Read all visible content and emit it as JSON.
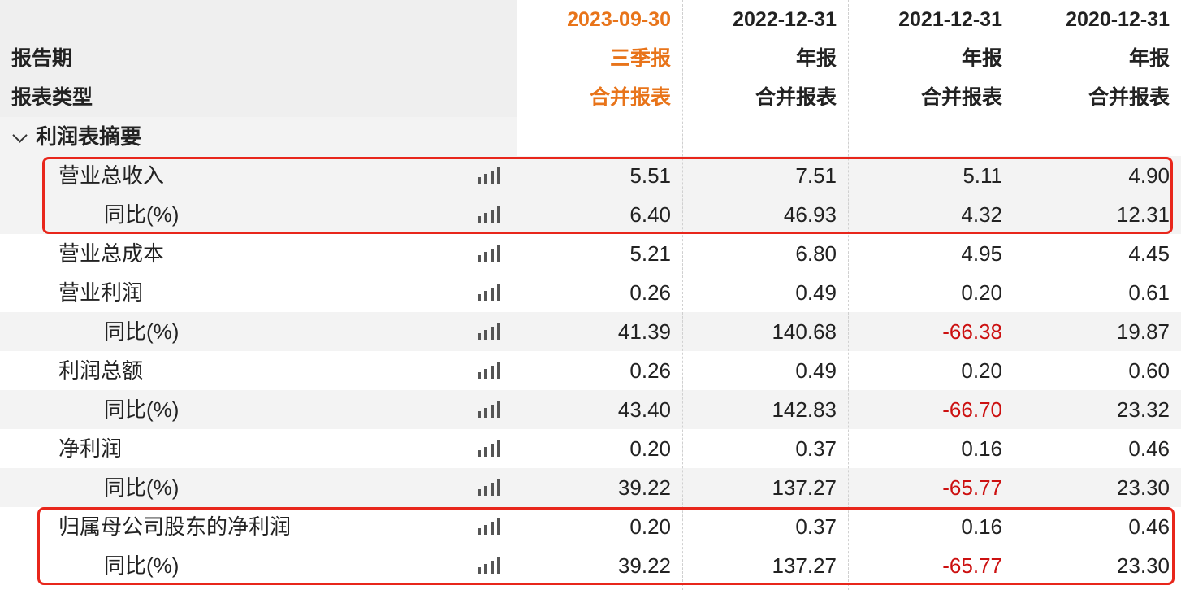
{
  "header": {
    "row_labels": [
      "报告期",
      "报表类型"
    ],
    "periods": [
      {
        "date": "2023-09-30",
        "report": "三季报",
        "type": "合并报表",
        "accent": "#e8741a"
      },
      {
        "date": "2022-12-31",
        "report": "年报",
        "type": "合并报表"
      },
      {
        "date": "2021-12-31",
        "report": "年报",
        "type": "合并报表"
      },
      {
        "date": "2020-12-31",
        "report": "年报",
        "type": "合并报表"
      }
    ]
  },
  "section": {
    "title": "利润表摘要",
    "icon": "chevron-down-icon"
  },
  "rows": [
    {
      "label": "营业总收入",
      "values": [
        "5.51",
        "7.51",
        "5.11",
        "4.90"
      ]
    },
    {
      "label": "同比(%)",
      "values": [
        "6.40",
        "46.93",
        "4.32",
        "12.31"
      ]
    },
    {
      "label": "营业总成本",
      "values": [
        "5.21",
        "6.80",
        "4.95",
        "4.45"
      ]
    },
    {
      "label": "营业利润",
      "values": [
        "0.26",
        "0.49",
        "0.20",
        "0.61"
      ]
    },
    {
      "label": "同比(%)",
      "values": [
        "41.39",
        "140.68",
        "-66.38",
        "19.87"
      ]
    },
    {
      "label": "利润总额",
      "values": [
        "0.26",
        "0.49",
        "0.20",
        "0.60"
      ]
    },
    {
      "label": "同比(%)",
      "values": [
        "43.40",
        "142.83",
        "-66.70",
        "23.32"
      ]
    },
    {
      "label": "净利润",
      "values": [
        "0.20",
        "0.37",
        "0.16",
        "0.46"
      ]
    },
    {
      "label": "同比(%)",
      "values": [
        "39.22",
        "137.27",
        "-65.77",
        "23.30"
      ]
    },
    {
      "label": "归属母公司股东的净利润",
      "values": [
        "0.20",
        "0.37",
        "0.16",
        "0.46"
      ]
    },
    {
      "label": "同比(%)",
      "values": [
        "39.22",
        "137.27",
        "-65.77",
        "23.30"
      ]
    }
  ],
  "colors": {
    "highlight_border": "#e8261b",
    "negative": "#cc1010",
    "accent": "#e8741a"
  },
  "row_icon": "bar-chart-icon"
}
